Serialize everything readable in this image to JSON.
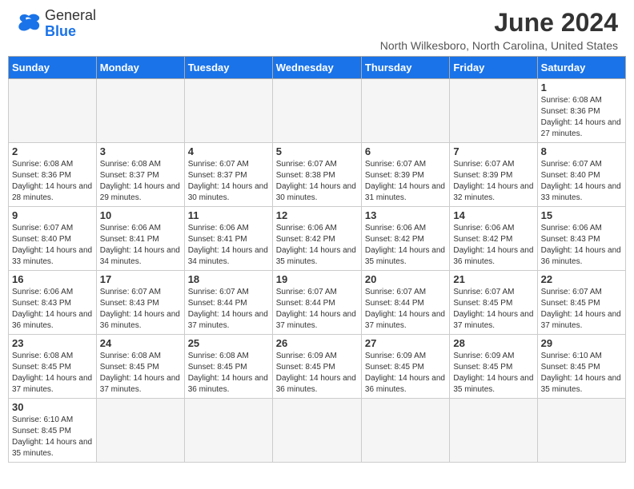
{
  "header": {
    "logo_general": "General",
    "logo_blue": "Blue",
    "month_title": "June 2024",
    "location": "North Wilkesboro, North Carolina, United States"
  },
  "weekdays": [
    "Sunday",
    "Monday",
    "Tuesday",
    "Wednesday",
    "Thursday",
    "Friday",
    "Saturday"
  ],
  "weeks": [
    [
      {
        "day": "",
        "empty": true
      },
      {
        "day": "",
        "empty": true
      },
      {
        "day": "",
        "empty": true
      },
      {
        "day": "",
        "empty": true
      },
      {
        "day": "",
        "empty": true
      },
      {
        "day": "",
        "empty": true
      },
      {
        "day": "1",
        "sunrise": "6:08 AM",
        "sunset": "8:36 PM",
        "daylight": "14 hours and 27 minutes."
      }
    ],
    [
      {
        "day": "2",
        "sunrise": "6:08 AM",
        "sunset": "8:36 PM",
        "daylight": "14 hours and 28 minutes."
      },
      {
        "day": "3",
        "sunrise": "6:08 AM",
        "sunset": "8:37 PM",
        "daylight": "14 hours and 29 minutes."
      },
      {
        "day": "4",
        "sunrise": "6:07 AM",
        "sunset": "8:37 PM",
        "daylight": "14 hours and 30 minutes."
      },
      {
        "day": "5",
        "sunrise": "6:07 AM",
        "sunset": "8:38 PM",
        "daylight": "14 hours and 30 minutes."
      },
      {
        "day": "6",
        "sunrise": "6:07 AM",
        "sunset": "8:39 PM",
        "daylight": "14 hours and 31 minutes."
      },
      {
        "day": "7",
        "sunrise": "6:07 AM",
        "sunset": "8:39 PM",
        "daylight": "14 hours and 32 minutes."
      },
      {
        "day": "8",
        "sunrise": "6:07 AM",
        "sunset": "8:40 PM",
        "daylight": "14 hours and 33 minutes."
      }
    ],
    [
      {
        "day": "9",
        "sunrise": "6:07 AM",
        "sunset": "8:40 PM",
        "daylight": "14 hours and 33 minutes."
      },
      {
        "day": "10",
        "sunrise": "6:06 AM",
        "sunset": "8:41 PM",
        "daylight": "14 hours and 34 minutes."
      },
      {
        "day": "11",
        "sunrise": "6:06 AM",
        "sunset": "8:41 PM",
        "daylight": "14 hours and 34 minutes."
      },
      {
        "day": "12",
        "sunrise": "6:06 AM",
        "sunset": "8:42 PM",
        "daylight": "14 hours and 35 minutes."
      },
      {
        "day": "13",
        "sunrise": "6:06 AM",
        "sunset": "8:42 PM",
        "daylight": "14 hours and 35 minutes."
      },
      {
        "day": "14",
        "sunrise": "6:06 AM",
        "sunset": "8:42 PM",
        "daylight": "14 hours and 36 minutes."
      },
      {
        "day": "15",
        "sunrise": "6:06 AM",
        "sunset": "8:43 PM",
        "daylight": "14 hours and 36 minutes."
      }
    ],
    [
      {
        "day": "16",
        "sunrise": "6:06 AM",
        "sunset": "8:43 PM",
        "daylight": "14 hours and 36 minutes."
      },
      {
        "day": "17",
        "sunrise": "6:07 AM",
        "sunset": "8:43 PM",
        "daylight": "14 hours and 36 minutes."
      },
      {
        "day": "18",
        "sunrise": "6:07 AM",
        "sunset": "8:44 PM",
        "daylight": "14 hours and 37 minutes."
      },
      {
        "day": "19",
        "sunrise": "6:07 AM",
        "sunset": "8:44 PM",
        "daylight": "14 hours and 37 minutes."
      },
      {
        "day": "20",
        "sunrise": "6:07 AM",
        "sunset": "8:44 PM",
        "daylight": "14 hours and 37 minutes."
      },
      {
        "day": "21",
        "sunrise": "6:07 AM",
        "sunset": "8:45 PM",
        "daylight": "14 hours and 37 minutes."
      },
      {
        "day": "22",
        "sunrise": "6:07 AM",
        "sunset": "8:45 PM",
        "daylight": "14 hours and 37 minutes."
      }
    ],
    [
      {
        "day": "23",
        "sunrise": "6:08 AM",
        "sunset": "8:45 PM",
        "daylight": "14 hours and 37 minutes."
      },
      {
        "day": "24",
        "sunrise": "6:08 AM",
        "sunset": "8:45 PM",
        "daylight": "14 hours and 37 minutes."
      },
      {
        "day": "25",
        "sunrise": "6:08 AM",
        "sunset": "8:45 PM",
        "daylight": "14 hours and 36 minutes."
      },
      {
        "day": "26",
        "sunrise": "6:09 AM",
        "sunset": "8:45 PM",
        "daylight": "14 hours and 36 minutes."
      },
      {
        "day": "27",
        "sunrise": "6:09 AM",
        "sunset": "8:45 PM",
        "daylight": "14 hours and 36 minutes."
      },
      {
        "day": "28",
        "sunrise": "6:09 AM",
        "sunset": "8:45 PM",
        "daylight": "14 hours and 35 minutes."
      },
      {
        "day": "29",
        "sunrise": "6:10 AM",
        "sunset": "8:45 PM",
        "daylight": "14 hours and 35 minutes."
      }
    ],
    [
      {
        "day": "30",
        "sunrise": "6:10 AM",
        "sunset": "8:45 PM",
        "daylight": "14 hours and 35 minutes."
      },
      {
        "day": "",
        "empty": true
      },
      {
        "day": "",
        "empty": true
      },
      {
        "day": "",
        "empty": true
      },
      {
        "day": "",
        "empty": true
      },
      {
        "day": "",
        "empty": true
      },
      {
        "day": "",
        "empty": true
      }
    ]
  ]
}
